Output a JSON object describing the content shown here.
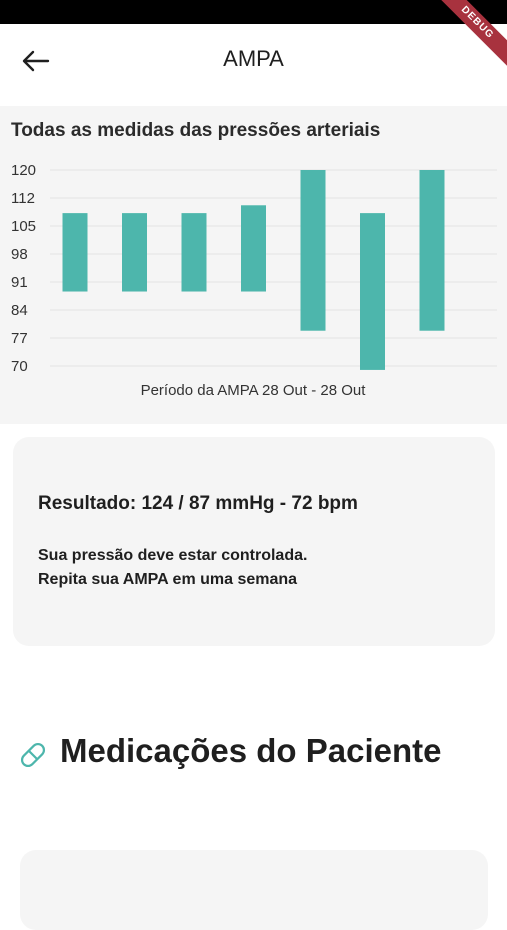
{
  "app_bar": {
    "title": "AMPA",
    "back_icon": "arrow-left-icon",
    "debug_banner": "DEBUG"
  },
  "chart_data": {
    "type": "bar",
    "title": "Todas as medidas das pressões arteriais",
    "xlabel": "Período da AMPA 28 Out - 28 Out",
    "ylabel": "",
    "ylim": [
      70,
      120
    ],
    "y_ticks": [
      "120",
      "112",
      "105",
      "98",
      "91",
      "84",
      "77",
      "70"
    ],
    "grid": true,
    "bar_color": "#4db6ac",
    "series": [
      {
        "ranges": [
          [
            89,
            109
          ],
          [
            89,
            109
          ],
          [
            89,
            109
          ],
          [
            89,
            111
          ],
          [
            79,
            120
          ],
          [
            69,
            109
          ],
          [
            79,
            120
          ]
        ]
      }
    ]
  },
  "result": {
    "heading": "Resultado: 124 / 87 mmHg - 72 bpm",
    "line1": "Sua pressão deve estar controlada.",
    "line2": "Repita sua AMPA em uma semana"
  },
  "medications": {
    "title": "Medicações do Paciente",
    "icon": "pill-icon",
    "icon_color": "#4db6ac"
  }
}
